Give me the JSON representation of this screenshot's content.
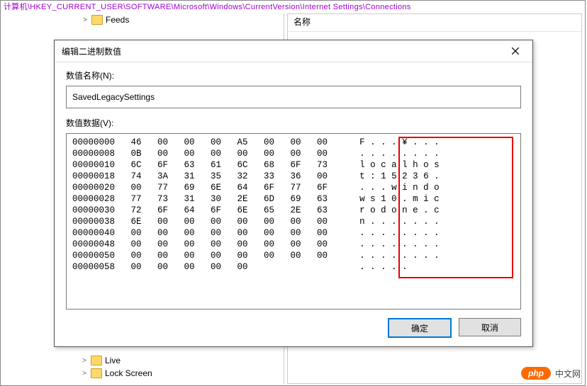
{
  "path_bar": "计算机\\HKEY_CURRENT_USER\\SOFTWARE\\Microsoft\\Windows\\CurrentVersion\\Internet Settings\\Connections",
  "tree": {
    "items": [
      {
        "label": "Feeds",
        "expanded": true
      },
      {
        "label": "Live",
        "expanded": true
      },
      {
        "label": "Lock Screen",
        "expanded": true
      }
    ]
  },
  "list": {
    "header": "名称"
  },
  "dialog": {
    "title": "编辑二进制数值",
    "name_label": "数值名称(N):",
    "name_value": "SavedLegacySettings",
    "data_label": "数值数据(V):",
    "ok": "确定",
    "cancel": "取消",
    "hex_rows": [
      {
        "off": "00000000",
        "b": [
          "46",
          "00",
          "00",
          "00",
          "A5",
          "00",
          "00",
          "00"
        ],
        "a": "F . . . ¥ . . ."
      },
      {
        "off": "00000008",
        "b": [
          "0B",
          "00",
          "00",
          "00",
          "00",
          "00",
          "00",
          "00"
        ],
        "a": ". . . . . . . ."
      },
      {
        "off": "00000010",
        "b": [
          "6C",
          "6F",
          "63",
          "61",
          "6C",
          "68",
          "6F",
          "73"
        ],
        "a": "l o c a l h o s"
      },
      {
        "off": "00000018",
        "b": [
          "74",
          "3A",
          "31",
          "35",
          "32",
          "33",
          "36",
          "00"
        ],
        "a": "t : 1 5 2 3 6 ."
      },
      {
        "off": "00000020",
        "b": [
          "00",
          "77",
          "69",
          "6E",
          "64",
          "6F",
          "77",
          "6F"
        ],
        "a": ". . . w i n d o"
      },
      {
        "off": "00000028",
        "b": [
          "77",
          "73",
          "31",
          "30",
          "2E",
          "6D",
          "69",
          "63"
        ],
        "a": "w s 1 0 . m i c"
      },
      {
        "off": "00000030",
        "b": [
          "72",
          "6F",
          "64",
          "6F",
          "6E",
          "65",
          "2E",
          "63"
        ],
        "a": "r o d o n e . c"
      },
      {
        "off": "00000038",
        "b": [
          "6E",
          "00",
          "00",
          "00",
          "00",
          "00",
          "00",
          "00"
        ],
        "a": "n . . . . . . ."
      },
      {
        "off": "00000040",
        "b": [
          "00",
          "00",
          "00",
          "00",
          "00",
          "00",
          "00",
          "00"
        ],
        "a": ". . . . . . . ."
      },
      {
        "off": "00000048",
        "b": [
          "00",
          "00",
          "00",
          "00",
          "00",
          "00",
          "00",
          "00"
        ],
        "a": ". . . . . . . ."
      },
      {
        "off": "00000050",
        "b": [
          "00",
          "00",
          "00",
          "00",
          "00",
          "00",
          "00",
          "00"
        ],
        "a": ". . . . . . . ."
      },
      {
        "off": "00000058",
        "b": [
          "00",
          "00",
          "00",
          "00",
          "00"
        ],
        "a": ". . . . ."
      }
    ]
  },
  "badge": {
    "pill": "php",
    "text": "中文网"
  }
}
